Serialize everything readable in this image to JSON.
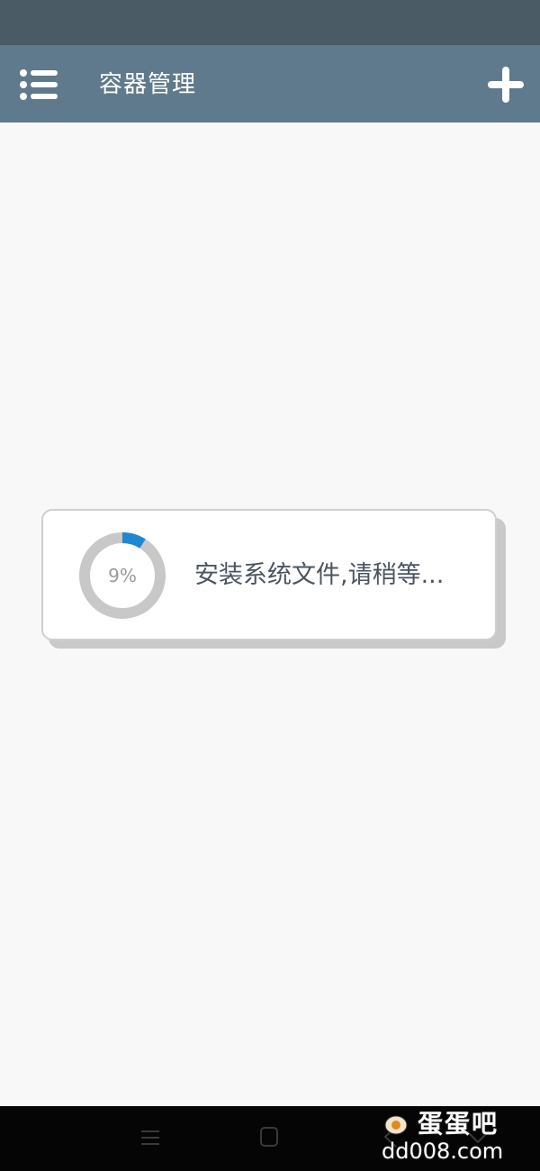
{
  "app_bar": {
    "title": "容器管理",
    "menu_icon": "list-menu-icon",
    "add_icon": "plus-icon"
  },
  "dialog": {
    "progress_percent": 9,
    "progress_label": "9%",
    "message": "安装系统文件,请稍等..."
  },
  "navigation_bar": {
    "icons": [
      "menu-icon",
      "home-icon",
      "back-icon",
      "recents-icon"
    ]
  },
  "watermark": {
    "name": "蛋蛋吧",
    "domain": "dd008.com"
  },
  "colors": {
    "status_bar": "#4a5b66",
    "app_bar": "#5f7a8c",
    "background": "#f8f8f8",
    "progress_fill": "#1e88d2",
    "progress_track": "#c8c8c8",
    "nav_bar": "#050505"
  }
}
